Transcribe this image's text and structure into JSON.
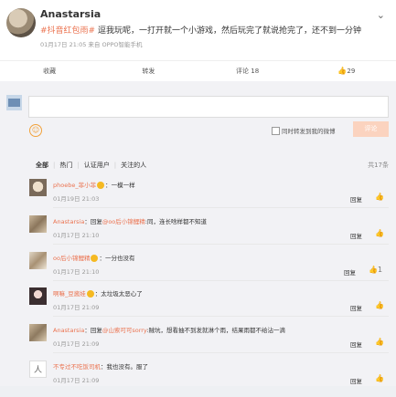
{
  "post": {
    "author": "Anastarsia",
    "topic": "#抖音红包雨#",
    "text": " 逗我玩呢，一打开就一个小游戏，然后玩完了就说抢完了，还不到一分钟",
    "meta": "01月17日 21:05 来自 OPPO智能手机",
    "chevron": "⌄"
  },
  "actions": {
    "favorite": "收藏",
    "repost": "转发",
    "comment": "评论 18",
    "like": "29"
  },
  "compose": {
    "forward_label": "同时转发到我的微博",
    "submit": "评论"
  },
  "filters": {
    "all": "全部",
    "hot": "热门",
    "verified": "认证用户",
    "following": "关注的人",
    "total": "共17条"
  },
  "comments": [
    {
      "user": "phoebe_菲小菲",
      "badge": true,
      "pre": "",
      "mention": "",
      "text": "：一模一样",
      "time": "01月19日 21:03",
      "reply": "回复",
      "like": ""
    },
    {
      "user": "Anastarsia",
      "badge": false,
      "pre": "：回复",
      "mention": "@oo后小锦鲤精",
      "text": ":同，连长啥样都不知道",
      "time": "01月17日 21:10",
      "reply": "回复",
      "like": ""
    },
    {
      "user": "oo后小锦鲤精",
      "badge": true,
      "pre": "",
      "mention": "",
      "text": "：一分也没有",
      "time": "01月17日 21:10",
      "reply": "回复",
      "like": "1"
    },
    {
      "user": "啊嘛_豆酱娃",
      "badge": true,
      "pre": "",
      "mention": "",
      "text": "：太垃圾太恶心了",
      "time": "01月17日 21:09",
      "reply": "回复",
      "like": ""
    },
    {
      "user": "Anastarsia",
      "badge": false,
      "pre": "：回复",
      "mention": "@山索可可sorry",
      "text": ":贼坑，想看抽不到发就淋个雨，结果雨都不给沾一滴",
      "time": "01月17日 21:09",
      "reply": "回复",
      "like": ""
    },
    {
      "user": "不专过不吃饭司机",
      "badge": false,
      "pre": "",
      "mention": "",
      "text": "：我也没有。服了",
      "time": "01月17日 21:09",
      "reply": "回复",
      "like": ""
    }
  ]
}
